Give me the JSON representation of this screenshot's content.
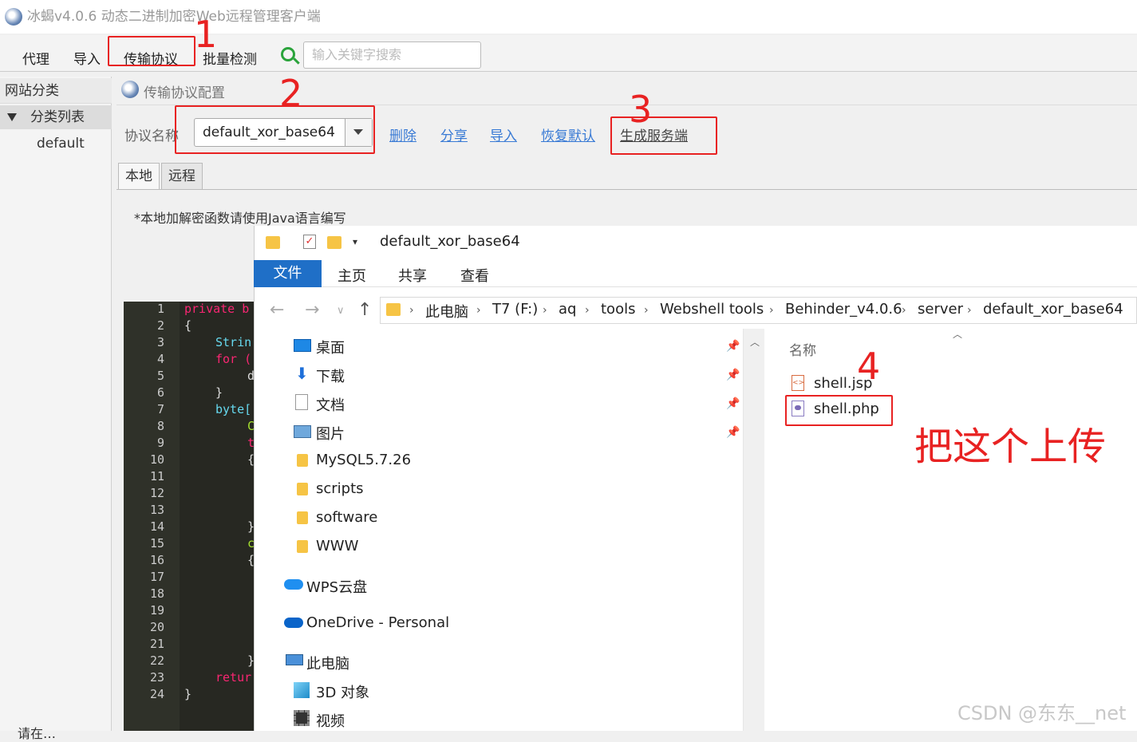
{
  "window": {
    "title": "冰蝎v4.0.6 动态二进制加密Web远程管理客户端"
  },
  "menu": {
    "items": [
      "代理",
      "导入",
      "传输协议",
      "批量检测"
    ],
    "search_placeholder": "输入关键字搜索"
  },
  "sidebar": {
    "title": "网站分类",
    "category": "分类列表",
    "items": [
      "default"
    ],
    "bottom_partial": "请在…"
  },
  "panel": {
    "title": "传输协议配置",
    "protocol_label": "协议名称",
    "protocol_value": "default_xor_base64",
    "links": [
      "删除",
      "分享",
      "导入",
      "恢复默认",
      "生成服务端"
    ],
    "tabs": [
      "本地",
      "远程"
    ],
    "hint": "*本地加解密函数请使用Java语言编写"
  },
  "editor": {
    "line_numbers": [
      "1",
      "2",
      "3",
      "4",
      "5",
      "6",
      "7",
      "8",
      "9",
      "10",
      "11",
      "12",
      "13",
      "14",
      "15",
      "16",
      "17",
      "18",
      "19",
      "20",
      "21",
      "22",
      "23",
      "24"
    ],
    "snippets": {
      "l1": "private b",
      "l2": "{",
      "l3": "Strin",
      "l4": "for (",
      "l5": "d",
      "l6": "}",
      "l7": "byte[",
      "l8": "C",
      "l9": "t",
      "l10": "{",
      "l14": "}",
      "l15": "c",
      "l16": "{",
      "l22": "}",
      "l23": "retur",
      "l24": "}"
    }
  },
  "explorer": {
    "title": "default_xor_base64",
    "ribbon": [
      "文件",
      "主页",
      "共享",
      "查看"
    ],
    "breadcrumb": [
      "此电脑",
      "T7 (F:)",
      "aq",
      "tools",
      "Webshell tools",
      "Behinder_v4.0.6",
      "server",
      "default_xor_base64"
    ],
    "quick_access": [
      "桌面",
      "下载",
      "文档",
      "图片",
      "MySQL5.7.26",
      "scripts",
      "software",
      "WWW"
    ],
    "other_nav": [
      "WPS云盘",
      "OneDrive - Personal",
      "此电脑",
      "3D 对象",
      "视频"
    ],
    "column_header": "名称",
    "files": [
      "shell.jsp",
      "shell.php"
    ]
  },
  "annotations": {
    "numbers": [
      "1",
      "2",
      "3",
      "4"
    ],
    "note": "把这个上传",
    "color": "#e82222"
  },
  "watermark": "CSDN @东东__net"
}
